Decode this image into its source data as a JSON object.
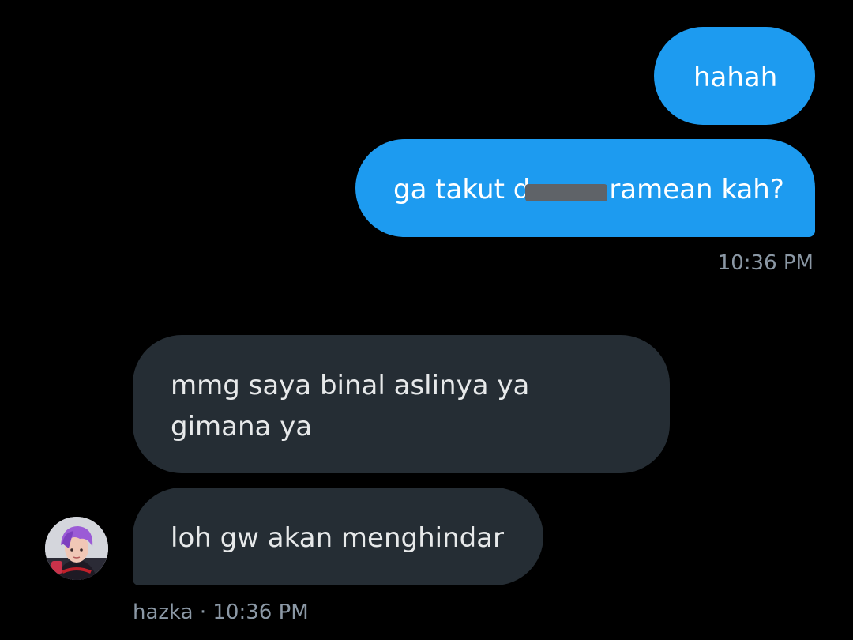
{
  "conversation": {
    "messages": [
      {
        "direction": "outgoing",
        "text": "hahah"
      },
      {
        "direction": "outgoing",
        "text_before": "ga takut d",
        "text_after": "ramean kah?",
        "redacted": true
      },
      {
        "direction": "incoming",
        "text": "mmg saya binal aslinya ya gimana ya"
      },
      {
        "direction": "incoming",
        "text": "loh gw akan menghindar"
      }
    ],
    "outgoing_timestamp": "10:36 PM",
    "incoming_footer": {
      "sender": "hazka",
      "separator": " · ",
      "time": "10:36 PM"
    }
  },
  "colors": {
    "background": "#000000",
    "outgoing_bubble": "#1d9bf0",
    "incoming_bubble": "#252d34",
    "timestamp": "#8b98a5"
  },
  "icons": {
    "avatar": "user-avatar-photo"
  }
}
